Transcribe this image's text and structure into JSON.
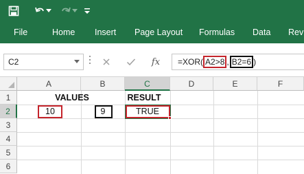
{
  "titlebar": {
    "save_icon": "save-icon",
    "undo_icon": "undo-icon",
    "redo_icon": "redo-icon",
    "customize_icon": "customize-toolbar-icon"
  },
  "ribbon": {
    "tabs": [
      "File",
      "Home",
      "Insert",
      "Page Layout",
      "Formulas",
      "Data",
      "Revi"
    ]
  },
  "formula_bar": {
    "name_box": "C2",
    "cancel_icon": "cancel-icon",
    "enter_icon": "check-icon",
    "fx_label": "fx",
    "formula_prefix": "=XOR(",
    "arg1": "A2>8",
    "sep": ",",
    "arg2": "B2=6",
    "formula_suffix": ")"
  },
  "grid": {
    "columns": [
      "A",
      "B",
      "C",
      "D",
      "E",
      "F"
    ],
    "rows": [
      "1",
      "2",
      "3",
      "4",
      "5",
      "6"
    ],
    "active_cell": "C2",
    "cells": {
      "A1": "VALUES",
      "C1": "RESULT",
      "A2": "10",
      "B2": "9",
      "C2": "TRUE"
    }
  },
  "colors": {
    "accent": "#217346",
    "highlight_red": "#c4242b",
    "highlight_black": "#111111"
  }
}
